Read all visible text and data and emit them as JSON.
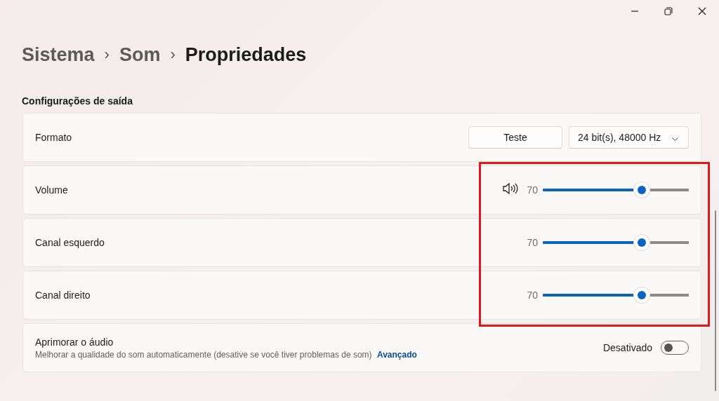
{
  "breadcrumb": [
    {
      "label": "Sistema",
      "current": false
    },
    {
      "label": "Som",
      "current": false
    },
    {
      "label": "Propriedades",
      "current": true
    }
  ],
  "breadcrumb_separator": "›",
  "section_title": "Configurações de saída",
  "rows": [
    {
      "kind": "format",
      "label": "Formato",
      "button": "Teste",
      "dropdown": {
        "value": "24 bit(s), 48000 Hz"
      }
    },
    {
      "kind": "slider",
      "label": "Volume",
      "icon": true,
      "reading": "70",
      "level": 0.68
    },
    {
      "kind": "slider",
      "label": "Canal esquerdo",
      "icon": false,
      "reading": "70",
      "level": 0.68
    },
    {
      "kind": "slider",
      "label": "Canal direito",
      "icon": false,
      "reading": "70",
      "level": 0.68
    },
    {
      "kind": "toggle",
      "label": "Aprimorar o áudio",
      "description": "Melhorar a qualidade do som automaticamente (desative se você tiver problemas de som)",
      "link": "Avançado",
      "state_text": "Desativado",
      "on": false
    }
  ]
}
